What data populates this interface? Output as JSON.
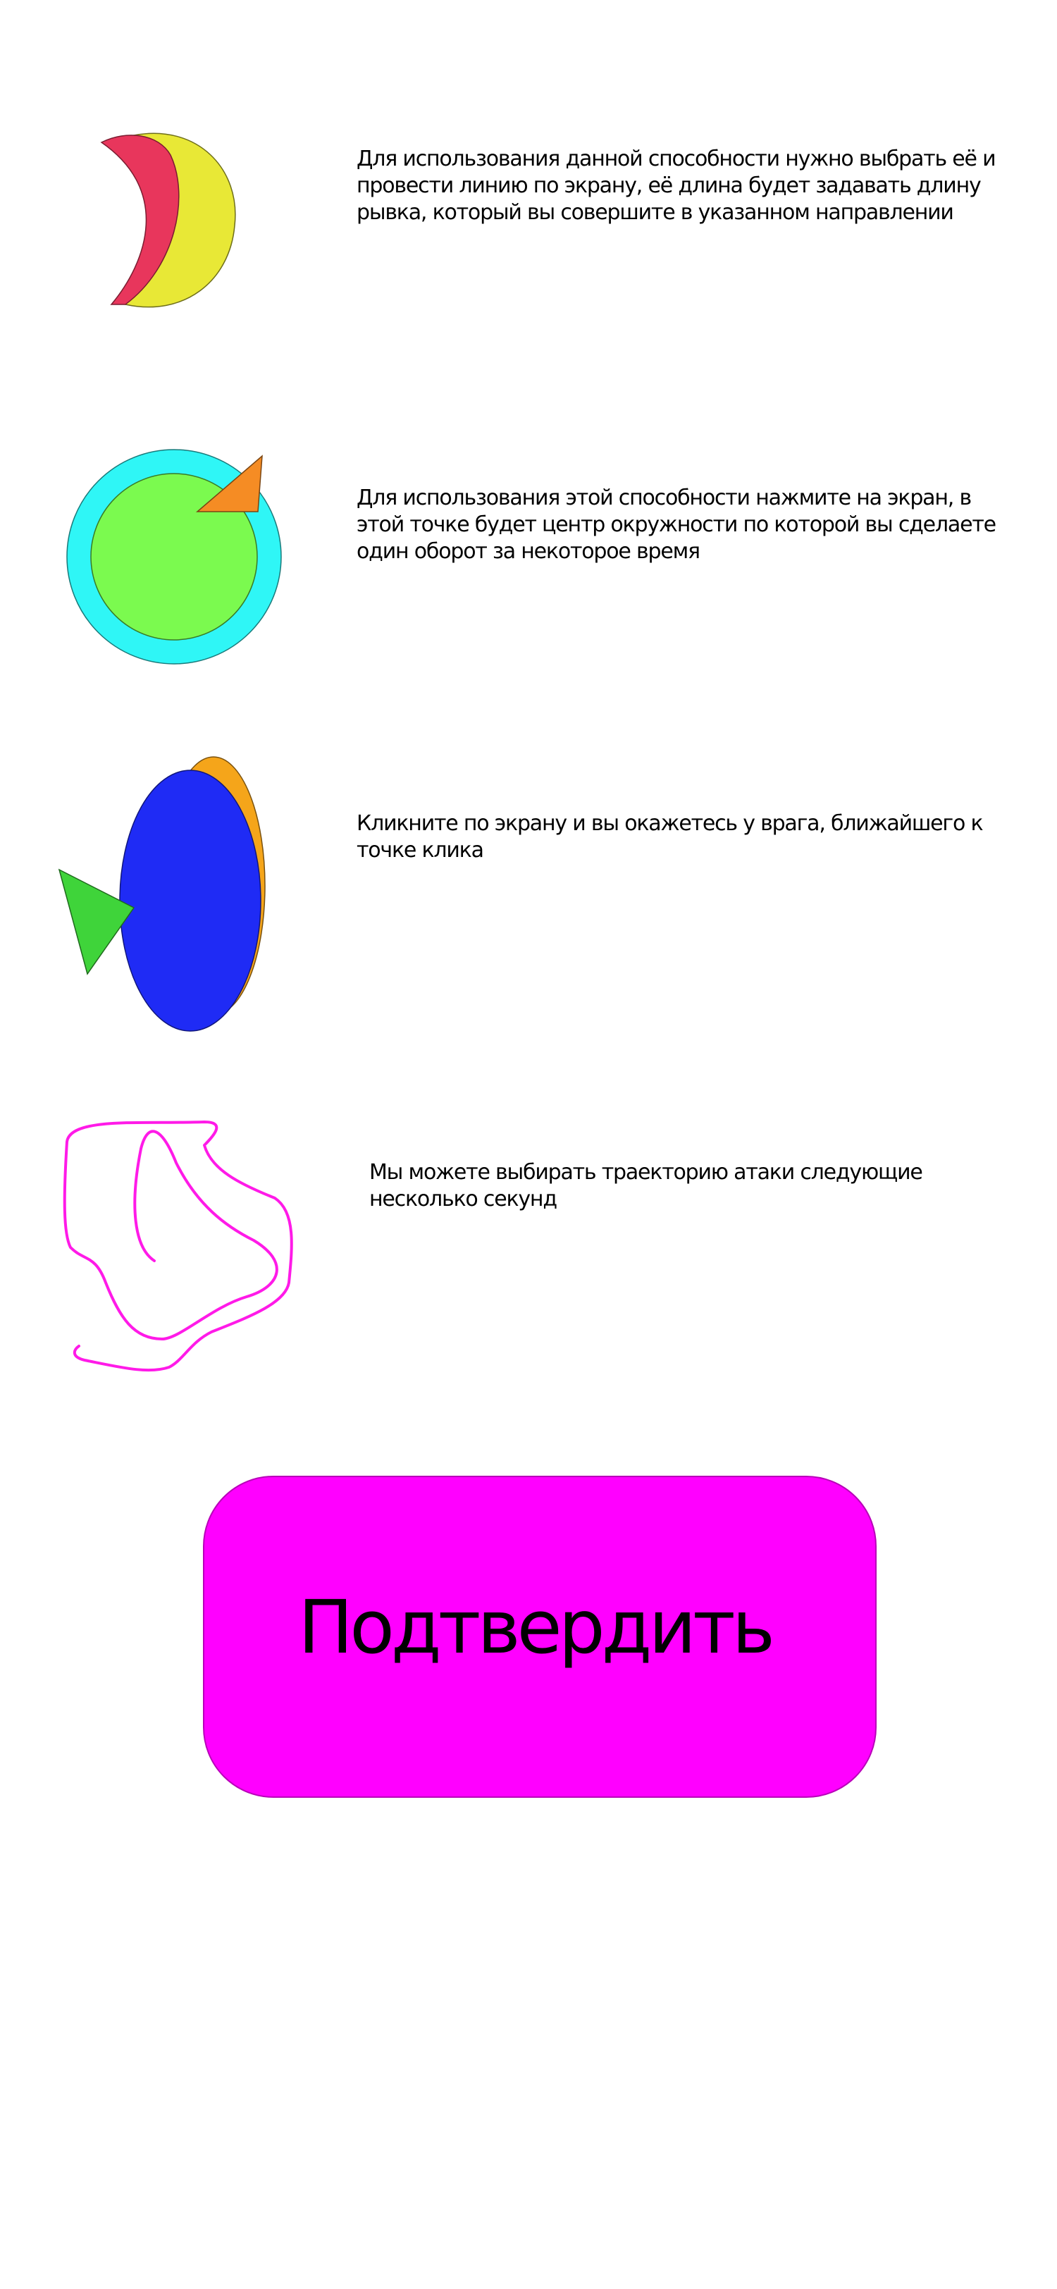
{
  "abilities": [
    {
      "icon": "crescent-moon-icon",
      "description": "Для использования данной способности нужно выбрать её и провести линию по экрану, её длина будет задавать длину рывка, который вы совершите в указанном направлении",
      "colors": {
        "moon": "#e8e836",
        "crescent": "#e8365c"
      }
    },
    {
      "icon": "circle-orbit-icon",
      "description": "Для использования этой способности нажмите на экран, в этой точке будет центр окружности по которой вы сделаете один оборот за некоторое время",
      "colors": {
        "ring": "#2ff6f6",
        "disc": "#7bfa4f",
        "pointer": "#f58c24"
      }
    },
    {
      "icon": "teleport-to-enemy-icon",
      "description": "Кликните по экрану и вы окажетесь у врага, ближайшего к точке клика",
      "colors": {
        "shadow": "#f5a51a",
        "body": "#1f2bf5",
        "pointer": "#3fd43a"
      }
    },
    {
      "icon": "trajectory-scribble-icon",
      "description": "Мы можете выбирать траекторию атаки следующие несколько секунд",
      "colors": {
        "stroke": "#ff1ae8"
      }
    }
  ],
  "confirm": {
    "label": "Подтвердить",
    "color": "#ff00ff"
  }
}
